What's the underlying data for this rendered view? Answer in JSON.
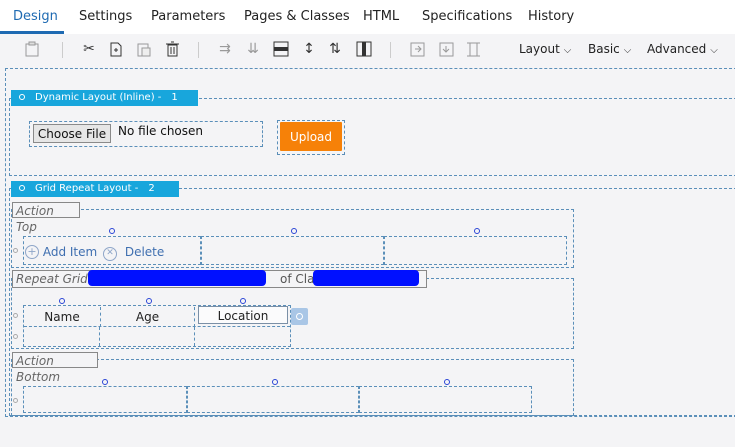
{
  "tabs": {
    "design": "Design",
    "settings": "Settings",
    "parameters": "Parameters",
    "pages_classes": "Pages & Classes",
    "html": "HTML",
    "specifications": "Specifications",
    "history": "History"
  },
  "toolbar": {
    "layout_menu": "Layout",
    "basic_menu": "Basic",
    "advanced_menu": "Advanced"
  },
  "dynamic_layout": {
    "header": "Dynamic Layout (Inline) -",
    "number": "1",
    "choose_file": "Choose File",
    "file_status": "No file chosen",
    "upload": "Upload"
  },
  "grid_repeat_layout": {
    "header": "Grid Repeat Layout -",
    "number": "2",
    "action_top": "Action Top",
    "add_item": "Add Item",
    "delete": "Delete",
    "repeat_grid_prefix": "Repeat Grid [",
    "of_class": "of Class",
    "columns": [
      "Name",
      "Age",
      "Location"
    ],
    "action_bottom": "Action Bottom"
  },
  "colors": {
    "accent": "#1e6ab2",
    "layout_header": "#18a6dc",
    "upload": "#f68108",
    "redaction": "#0010ff"
  }
}
